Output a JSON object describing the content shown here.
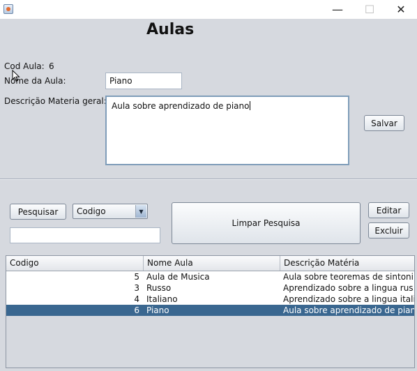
{
  "window": {
    "minimize_glyph": "—",
    "maximize_glyph": "☐",
    "close_glyph": "✕"
  },
  "form": {
    "title": "Aulas",
    "cod_label": "Cod Aula:",
    "cod_value": "6",
    "nome_label": "Nome da Aula:",
    "nome_value": "Piano",
    "descricao_label": "Descrição Materia geral:",
    "descricao_value": "Aula sobre aprendizado de piano",
    "salvar_label": "Salvar"
  },
  "search": {
    "pesquisar_label": "Pesquisar",
    "filter_selected": "Codigo",
    "query_value": "",
    "limpar_label": "Limpar Pesquisa",
    "editar_label": "Editar",
    "excluir_label": "Excluir"
  },
  "table": {
    "columns": [
      "Codigo",
      "Nome Aula",
      "Descrição Matéria"
    ],
    "rows": [
      {
        "codigo": "5",
        "nome": "Aula de Musica",
        "descricao": "Aula sobre teoremas de sintoni...",
        "selected": false
      },
      {
        "codigo": "3",
        "nome": "Russo",
        "descricao": "Aprendizado sobre a lingua rus...",
        "selected": false
      },
      {
        "codigo": "4",
        "nome": "Italiano",
        "descricao": "Aprendizado sobre a lingua itali...",
        "selected": false
      },
      {
        "codigo": "6",
        "nome": "Piano",
        "descricao": "Aula sobre aprendizado de piano",
        "selected": true
      }
    ]
  },
  "colors": {
    "selection": "#3a6790",
    "window_bg": "#d6d9df"
  }
}
